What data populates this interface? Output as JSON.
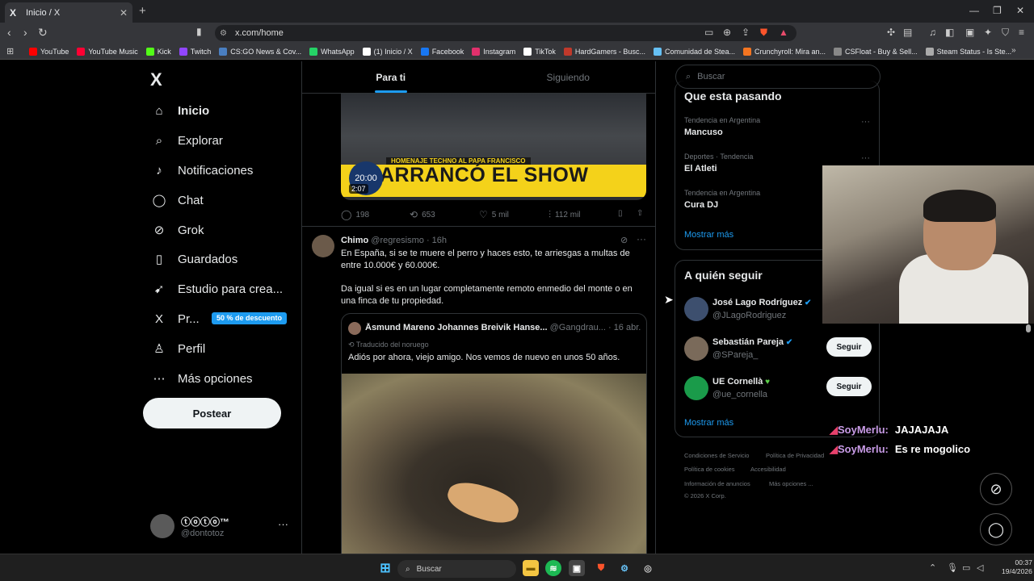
{
  "browser": {
    "tab_title": "Inicio / X",
    "tab_favicon": "X",
    "url": "x.com/home",
    "bookmarks": [
      {
        "label": "YouTube",
        "color": "#ff0000"
      },
      {
        "label": "YouTube Music",
        "color": "#ff0033"
      },
      {
        "label": "Kick",
        "color": "#53fc18"
      },
      {
        "label": "Twitch",
        "color": "#9146ff"
      },
      {
        "label": "CS:GO News & Cov...",
        "color": "#4a7fc1"
      },
      {
        "label": "WhatsApp",
        "color": "#25d366"
      },
      {
        "label": "(1) Inicio / X",
        "color": "#ffffff"
      },
      {
        "label": "Facebook",
        "color": "#1877f2"
      },
      {
        "label": "Instagram",
        "color": "#e1306c"
      },
      {
        "label": "TikTok",
        "color": "#ffffff"
      },
      {
        "label": "HardGamers - Busc...",
        "color": "#c0392b"
      },
      {
        "label": "Comunidad de Stea...",
        "color": "#66c0f4"
      },
      {
        "label": "Crunchyroll: Mira an...",
        "color": "#f47521"
      },
      {
        "label": "CSFloat - Buy & Sell...",
        "color": "#888888"
      },
      {
        "label": "Steam Status - Is Ste...",
        "color": "#aaaaaa"
      }
    ]
  },
  "sidebar": {
    "logo": "X",
    "items": [
      {
        "label": "Inicio",
        "icon": "home-icon"
      },
      {
        "label": "Explorar",
        "icon": "search-icon"
      },
      {
        "label": "Notificaciones",
        "icon": "bell-icon"
      },
      {
        "label": "Chat",
        "icon": "chat-icon"
      },
      {
        "label": "Grok",
        "icon": "grok-icon"
      },
      {
        "label": "Guardados",
        "icon": "bookmark-icon"
      },
      {
        "label": "Estudio para crea...",
        "icon": "creator-studio-icon"
      },
      {
        "label": "Pr...",
        "icon": "x-premium-icon"
      },
      {
        "label": "Perfil",
        "icon": "person-icon"
      },
      {
        "label": "Más opciones",
        "icon": "more-circle-icon"
      }
    ],
    "promo_badge": "50 % de descuento",
    "post_button": "Postear",
    "user": {
      "name": "ⓣⓞⓣⓞ™",
      "handle": "@dontotoz",
      "more": "···"
    }
  },
  "timeline": {
    "tabs": [
      "Para ti",
      "Siguiendo"
    ],
    "video": {
      "banner_sub": "HOMENAJE TECHNO AL PAPA FRANCISCO",
      "banner_title": "ARRANCÓ EL SHOW",
      "clock": "20:00",
      "duration": "2:07"
    },
    "actions": {
      "replies": "198",
      "reposts": "653",
      "likes": "5 mil",
      "views": "112 mil"
    },
    "tweet": {
      "name": "Chimo",
      "handle": "@regresismo",
      "time": "· 16h",
      "text1": "En España, si se te muere el perro y haces esto, te arriesgas a multas de entre 10.000€ y 60.000€.",
      "text2": "Da igual si es en un lugar completamente remoto enmedio del monte o en una finca de tu propiedad.",
      "quote": {
        "name": "Åsmund Mareno Johannes Breivik Hanse...",
        "handle": "@Gangdrau...",
        "time": "· 16 abr.",
        "translated": "Traducido del noruego",
        "text": "Adiós por ahora, viejo amigo. Nos vemos de nuevo en unos 50 años."
      }
    }
  },
  "right": {
    "search_placeholder": "Buscar",
    "trends_title": "Que esta pasando",
    "trends": [
      {
        "category": "Tendencia en Argentina",
        "name": "Mancuso"
      },
      {
        "category": "Deportes · Tendencia",
        "name": "El Atleti"
      },
      {
        "category": "Tendencia en Argentina",
        "name": "Cura DJ"
      }
    ],
    "show_more": "Mostrar más",
    "follow_title": "A quién seguir",
    "follow": [
      {
        "name": "José Lago Rodríguez",
        "handle": "@JLagoRodriguez",
        "button": "",
        "avatar_color": "#3d4f6e"
      },
      {
        "name": "Sebastián Pareja",
        "handle": "@SPareja_",
        "button": "Seguir",
        "avatar_color": "#7a6a5a"
      },
      {
        "name": "UE Cornellà",
        "handle": "@ue_cornella",
        "button": "Seguir",
        "avatar_color": "#1a9b4a"
      }
    ],
    "footer": [
      "Condiciones de Servicio",
      "Política de Privacidad",
      "Política de cookies",
      "Accesibilidad",
      "Información de anuncios",
      "Más opciones ...",
      "© 2026 X Corp."
    ]
  },
  "stream_chat": [
    {
      "user": "SoyMerlu:",
      "msg": "JAJAJAJA"
    },
    {
      "user": "SoyMerlu:",
      "msg": "Es re mogolico"
    }
  ],
  "taskbar": {
    "search": "Buscar",
    "time": "00:37",
    "date": "19/4/2026"
  }
}
